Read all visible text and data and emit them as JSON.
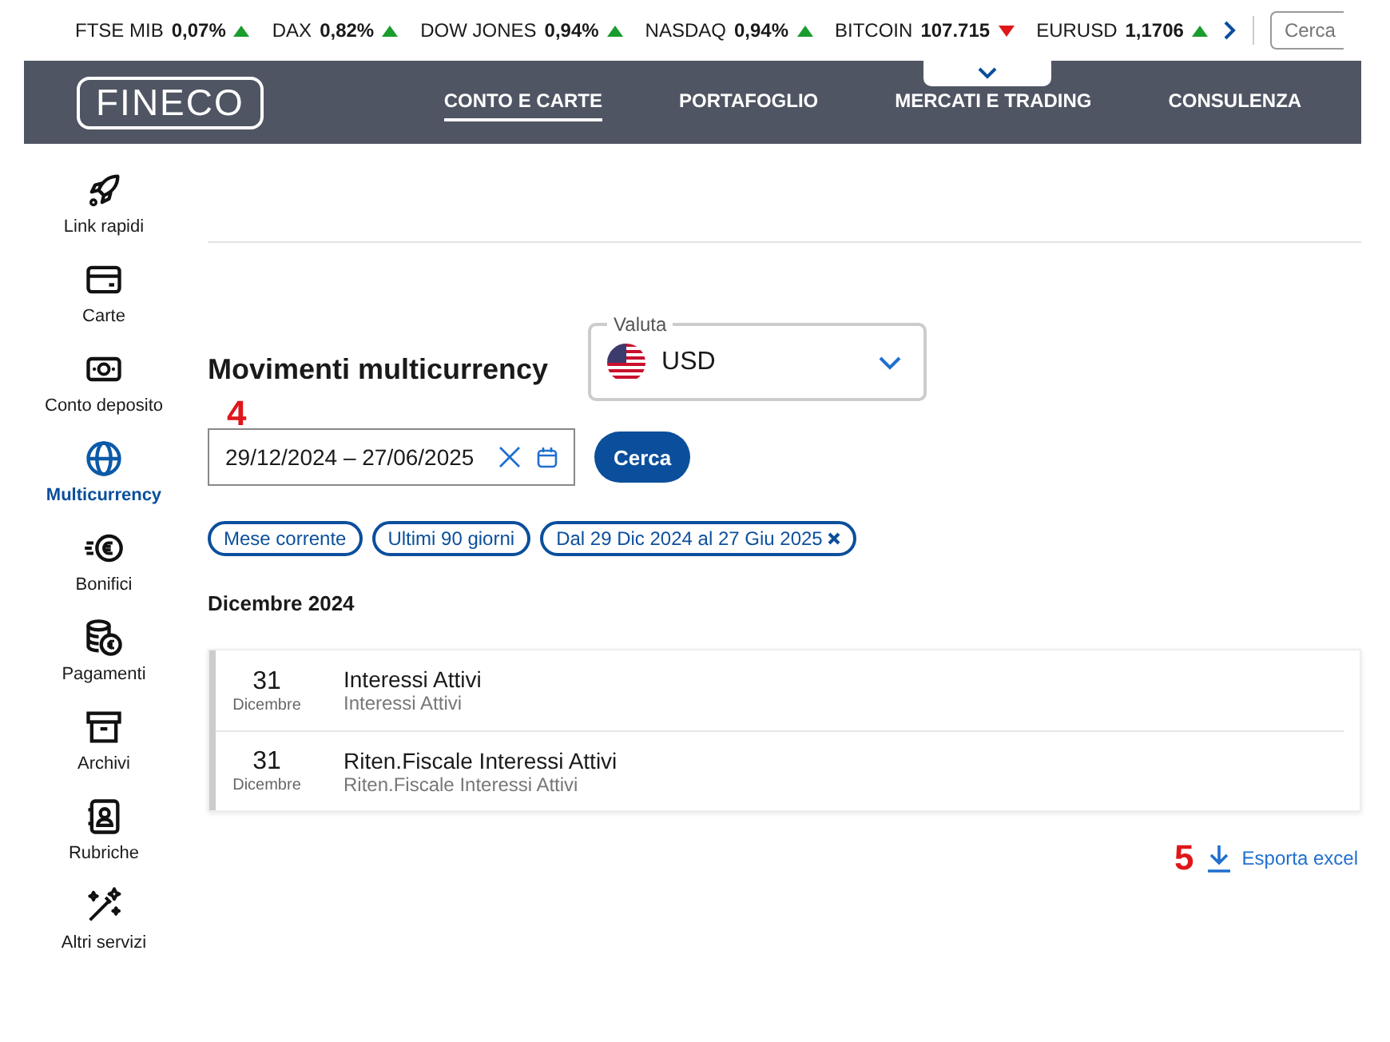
{
  "ticker": [
    {
      "name": "FTSE MIB",
      "value": "0,07%",
      "rising": true
    },
    {
      "name": "DAX",
      "value": "0,82%",
      "rising": true
    },
    {
      "name": "DOW JONES",
      "value": "0,94%",
      "rising": true
    },
    {
      "name": "NASDAQ",
      "value": "0,94%",
      "rising": true
    },
    {
      "name": "BITCOIN",
      "value": "107.715",
      "rising": false
    },
    {
      "name": "EURUSD",
      "value": "1,1706",
      "rising": true
    }
  ],
  "search": {
    "placeholder": "Cerca"
  },
  "header": {
    "logo": "FINECO",
    "nav": [
      {
        "label": "CONTO E CARTE",
        "selected": true
      },
      {
        "label": "PORTAFOGLIO",
        "selected": false
      },
      {
        "label": "MERCATI E TRADING",
        "selected": false
      },
      {
        "label": "CONSULENZA",
        "selected": false
      }
    ]
  },
  "sidebar": {
    "items": [
      {
        "label": "Link rapidi",
        "selected": false
      },
      {
        "label": "Carte",
        "selected": false
      },
      {
        "label": "Conto deposito",
        "selected": false
      },
      {
        "label": "Multicurrency",
        "selected": true
      },
      {
        "label": "Bonifici",
        "selected": false
      },
      {
        "label": "Pagamenti",
        "selected": false
      },
      {
        "label": "Archivi",
        "selected": false
      },
      {
        "label": "Rubriche",
        "selected": false
      },
      {
        "label": "Altri servizi",
        "selected": false
      }
    ]
  },
  "main": {
    "title": "Movimenti multicurrency",
    "currency": {
      "label": "Valuta",
      "value": "USD"
    },
    "date_range": {
      "value": "29/12/2024 – 27/06/2025"
    },
    "search_button": "Cerca",
    "filters": [
      {
        "label": "Mese corrente",
        "removable": false
      },
      {
        "label": "Ultimi 90 giorni",
        "removable": false
      },
      {
        "label": "Dal 29 Dic 2024 al 27 Giu 2025",
        "removable": true
      }
    ],
    "month": "Dicembre 2024",
    "movements": [
      {
        "day": "31",
        "month": "Dicembre",
        "title": "Interessi Attivi",
        "subtitle": "Interessi Attivi"
      },
      {
        "day": "31",
        "month": "Dicembre",
        "title": "Riten.Fiscale Interessi Attivi",
        "subtitle": "Riten.Fiscale Interessi Attivi"
      }
    ],
    "export": "Esporta excel",
    "annotations": [
      "4",
      "5"
    ]
  }
}
